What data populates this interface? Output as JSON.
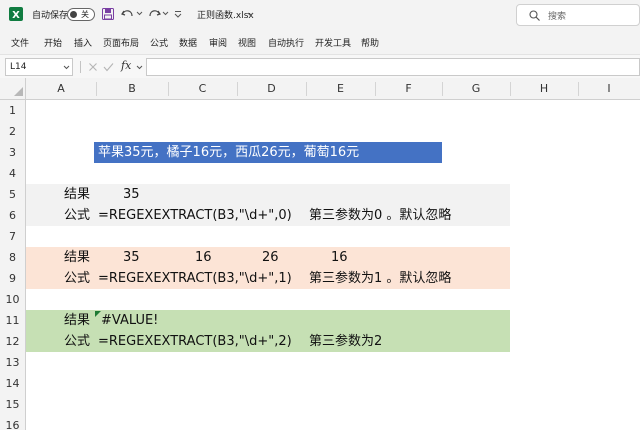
{
  "titlebar": {
    "autosave_label": "自动保存",
    "toggle_text": "关",
    "file_name": "正则函数.xlsx",
    "search_placeholder": "搜索"
  },
  "ribbon": {
    "tabs": [
      "文件",
      "开始",
      "插入",
      "页面布局",
      "公式",
      "数据",
      "审阅",
      "视图",
      "自动执行",
      "开发工具",
      "帮助"
    ]
  },
  "formula_bar": {
    "name_box": "L14",
    "fx_label": "fx",
    "content": ""
  },
  "columns": [
    "A",
    "B",
    "C",
    "D",
    "E",
    "F",
    "G",
    "H",
    "I"
  ],
  "rows": [
    "1",
    "2",
    "3",
    "4",
    "5",
    "6",
    "7",
    "8",
    "9",
    "10",
    "11",
    "12",
    "13",
    "14",
    "15",
    "16"
  ],
  "cells": {
    "b3": "苹果35元，橘子16元，西瓜26元，葡萄16元",
    "a5": "结果",
    "b5": "35",
    "a6": "公式",
    "b6": "=REGEXEXTRACT(B3,\"\\d+\",0)",
    "e6": "第三参数为0 。默认忽略",
    "a8": "结果",
    "b8": "35",
    "c8": "16",
    "d8": "26",
    "e8": "16",
    "a9": "公式",
    "b9": "=REGEXEXTRACT(B3,\"\\d+\",1)",
    "e9": "第三参数为1 。默认忽略",
    "a11": "结果",
    "b11": "#VALUE!",
    "a12": "公式",
    "b12": "=REGEXEXTRACT(B3,\"\\d+\",2)",
    "e12": "第三参数为2"
  },
  "colors": {
    "highlight_blue": "#4472c4",
    "band_gray": "#f2f2f2",
    "band_orange": "#fce4d6",
    "band_green": "#c6e0b4",
    "excel_green": "#107c41",
    "error_triangle": "#1e7b34"
  },
  "icons": [
    "excel-logo-icon",
    "save-icon",
    "undo-icon",
    "redo-icon",
    "customize-qat-icon",
    "chevron-down-icon",
    "search-icon",
    "cancel-icon",
    "enter-icon"
  ]
}
